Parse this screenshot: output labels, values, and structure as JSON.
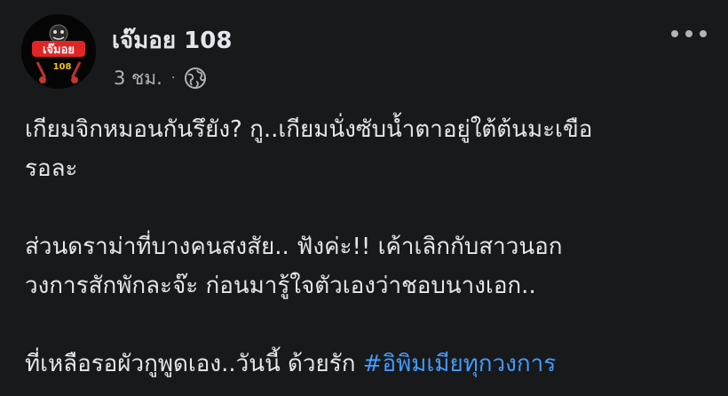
{
  "post": {
    "author": "เจ๊มอย 108",
    "time": "3 ชม.",
    "separator": "·",
    "privacy_icon": "globe-icon",
    "more_icon": "more-icon",
    "avatar": {
      "logo_text": "เจ๊มอย",
      "logo_number": "108"
    },
    "paragraphs": [
      "เกียมจิกหมอนกันรึยัง? กู..เกียมนั่งซับน้ำตาอยู่ใต้ต้นมะเขือ",
      "รอละ",
      "ส่วนดราม่าที่บางคนสงสัย.. ฟังค่ะ!! เค้าเลิกกับสาวนอก",
      "วงการสักพักละจ๊ะ ก่อนมารู้ใจตัวเองว่าชอบนางเอก..",
      "ที่เหลือรอผัวกูพูดเอง..วันนี้ ด้วยรัก"
    ],
    "hashtag": "#อิพิมเมียทุกวงการ"
  },
  "colors": {
    "background": "#18191a",
    "text_primary": "#e4e6eb",
    "text_secondary": "#b0b3b8",
    "link": "#4599ff"
  }
}
